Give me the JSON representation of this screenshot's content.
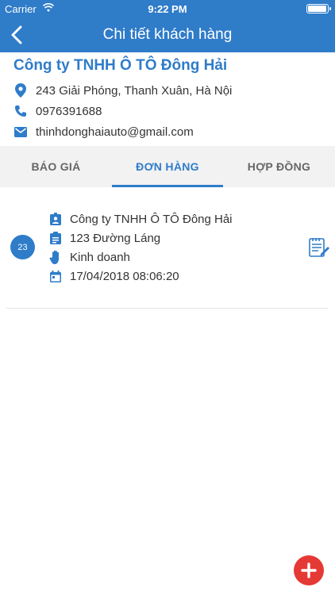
{
  "status_bar": {
    "carrier": "Carrier",
    "time": "9:22 PM",
    "battery_level": 0.9
  },
  "nav": {
    "title": "Chi tiết khách hàng",
    "back_icon": "chevron-left-icon"
  },
  "customer": {
    "name": "Công ty TNHH Ô TÔ Đông Hải",
    "address": "243 Giải Phóng, Thanh Xuân, Hà Nội",
    "phone": "0976391688",
    "email": "thinhdonghaiauto@gmail.com"
  },
  "tabs": [
    {
      "label": "BÁO GIÁ",
      "active": false
    },
    {
      "label": "ĐƠN HÀNG",
      "active": true
    },
    {
      "label": "HỢP ĐỒNG",
      "active": false
    }
  ],
  "orders": [
    {
      "number": "23",
      "company": "Công ty TNHH Ô TÔ Đông Hải",
      "address": "123 Đường Láng",
      "department": "Kinh doanh",
      "datetime": "17/04/2018 08:06:20"
    }
  ],
  "colors": {
    "primary": "#2f7cc9",
    "fab": "#e53935",
    "tab_bg": "#f2f2f2"
  }
}
